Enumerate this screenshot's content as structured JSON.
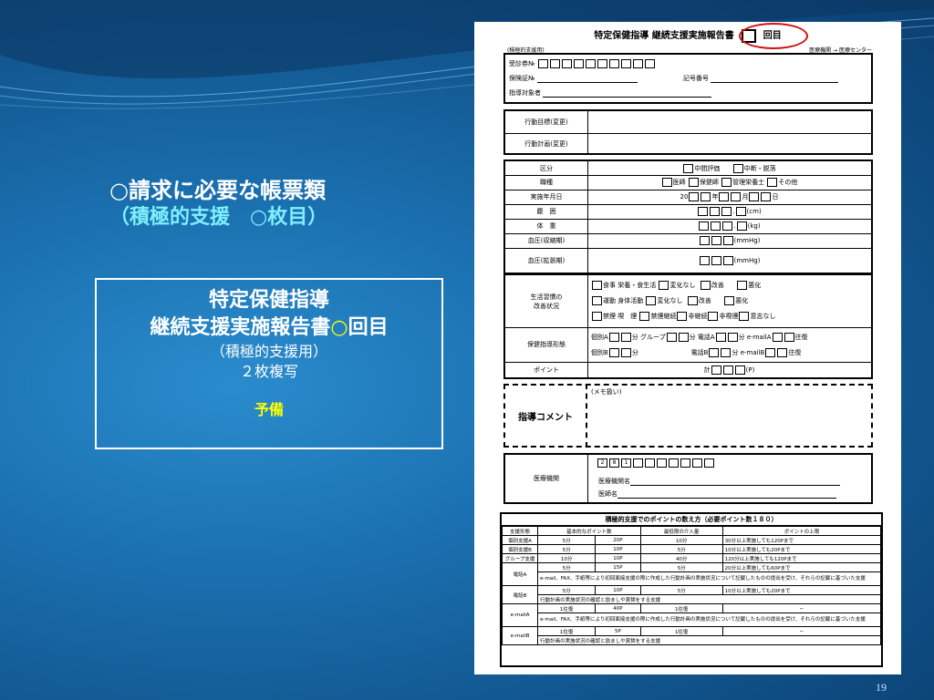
{
  "slide": {
    "heading_line1": "○請求に必要な帳票類",
    "heading_line2": "（積極的支援　○枚目）",
    "box_title1": "特定保健指導",
    "box_title2_a": "継続支援実施報告書",
    "box_title2_circle": "○",
    "box_title2_b": "回目",
    "box_sub1": "（積極的支援用）",
    "box_sub2": "２枚複写",
    "box_note": "予備",
    "slide_number": "19"
  },
  "form": {
    "title": "特定保健指導 継続支援実施報告書",
    "title_suffix": "回目",
    "left_caption": "(積極的支援用)",
    "right_caption": "医療機関 → 医療センター",
    "id_fields": {
      "voucher_no": "受診券№",
      "insurance_no": "保険証№",
      "symbol_no": "記号番号",
      "target_person": "指導対象者"
    },
    "plan": {
      "goal": "行動目標(変更)",
      "plan": "行動計画(変更)"
    },
    "eval": {
      "kubun": "区分",
      "mid": "中間評価",
      "stop": "中断・脱落",
      "job": "職種",
      "doctor": "医師",
      "nurse": "保健師",
      "dietitian": "管理栄養士",
      "other": "その他",
      "date": "実施年月日",
      "year_prefix": "20",
      "year": "年",
      "month": "月",
      "day": "日",
      "waist": "腹　囲",
      "waist_unit": "(cm)",
      "weight": "体　重",
      "weight_unit": "(kg)",
      "sbp": "血圧(収縮期)",
      "dbp": "血圧(拡張期)",
      "bp_unit": "(mmHg)"
    },
    "lifestyle": {
      "label_a": "生活習慣の",
      "label_b": "改善状況",
      "diet": "食事",
      "diet2": "栄養・食生活",
      "exercise": "運動",
      "exercise2": "身体活動",
      "smoke": "禁煙",
      "smoke2": "喫　煙",
      "nochange": "変化なし",
      "improve": "改善",
      "worse": "悪化",
      "kin": "禁煙継続",
      "notcont": "非継続",
      "nonsmoker": "非喫煙",
      "intent": "意志なし"
    },
    "form_type": {
      "label": "保健指導形態",
      "kobetsu_a": "個別A",
      "kobetsu_b": "個別B",
      "min": "分",
      "group": "グループ",
      "tel_a": "電話A",
      "tel_b": "電話B",
      "mail_a": "e-mailA",
      "mail_b": "e-mailB",
      "roundtrip": "往復"
    },
    "point": {
      "label": "ポイント",
      "total": "計",
      "unit": "(P)"
    },
    "comment": {
      "label": "指導コメント",
      "memo": "(メモ扱い)"
    },
    "institution": {
      "label": "医療機関",
      "code_digits": [
        "2",
        "8",
        "1"
      ],
      "name": "医療機関名",
      "doctor": "医師名"
    },
    "points_table": {
      "title": "積極的支援でのポイントの数え方（必要ポイント数１８０）",
      "headers": [
        "支援形態",
        "基本的なポイント数",
        "最低限の介入量",
        "ポイントの上限"
      ],
      "rows": [
        [
          "個別支援A",
          "5分",
          "20P",
          "10分",
          "30分以上実施しても120Pまで"
        ],
        [
          "個別支援B",
          "5分",
          "10P",
          "5分",
          "10分以上実施しても20Pまで"
        ],
        [
          "グループ支援",
          "10分",
          "10P",
          "40分",
          "120分以上実施しても120Pまで"
        ],
        [
          "電話A",
          "5分",
          "15P",
          "5分",
          "20分以上実施しても60Pまで"
        ],
        [
          "電話B",
          "5分",
          "10P",
          "5分",
          "10分以上実施しても20Pまで"
        ],
        [
          "e-mailA",
          "1往復",
          "40P",
          "1往復",
          "−"
        ],
        [
          "e-mailB",
          "1往復",
          "5P",
          "1往復",
          "−"
        ]
      ],
      "note_tel_a": "e-mail、FAX、手紙等により初回面接支援の際に作成した行動計画の実施状況について記載したものの提出を受け、それらの記載に基づいた支援",
      "note_tel_b": "行動計画の実施状況の確認と励ましや賞賛をする支援"
    }
  }
}
